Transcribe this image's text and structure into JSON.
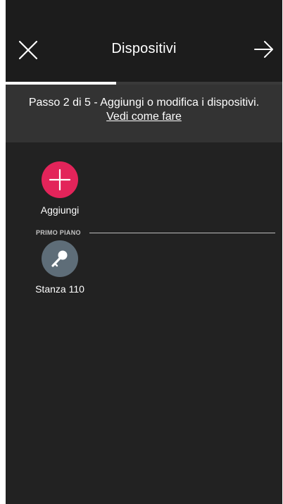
{
  "header": {
    "title": "Dispositivi",
    "close_icon": "close-icon",
    "next_icon": "arrow-right-icon"
  },
  "progress": {
    "current_step": 2,
    "total_steps": 5,
    "fraction": 0.4
  },
  "banner": {
    "step_text": "Passo 2 di 5 - Aggiungi o modifica i dispositivi.",
    "help_link": "Vedi come fare"
  },
  "add_tile": {
    "label": "Aggiungi",
    "icon": "plus-icon",
    "color": "#e3245a"
  },
  "sections": [
    {
      "title": "PRIMO PIANO",
      "rooms": [
        {
          "label": "Stanza 110",
          "icon": "key-icon",
          "color": "#5e6d78"
        }
      ]
    }
  ],
  "colors": {
    "background": "#222222",
    "header": "#1c1c1c",
    "banner": "#333333",
    "accent": "#e3245a"
  }
}
